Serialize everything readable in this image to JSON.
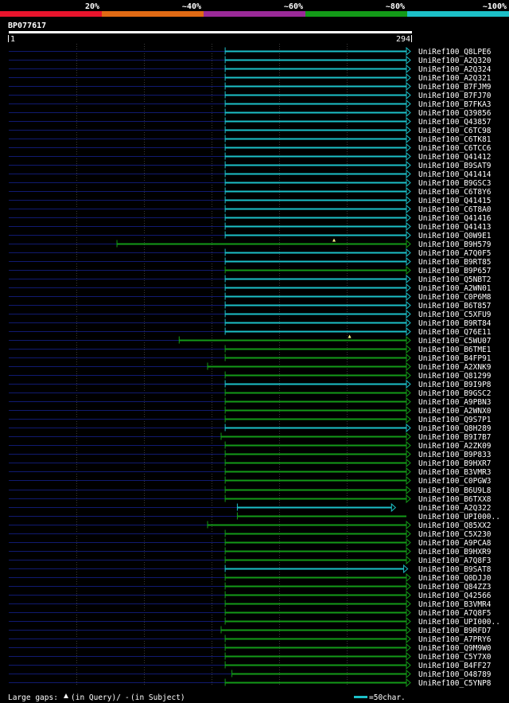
{
  "chart_data": {
    "type": "alignment",
    "query": {
      "name": "BP077617",
      "length": 294,
      "start_label": "1",
      "end_label": "294"
    },
    "identity_legend": [
      {
        "label": "20%",
        "color": "#e8142c"
      },
      {
        "label": "~40%",
        "color": "#e06a14"
      },
      {
        "label": "~60%",
        "color": "#9a2a98"
      },
      {
        "label": "~80%",
        "color": "#139a18"
      },
      {
        "label": "~100%",
        "color": "#1cc0c8"
      }
    ],
    "colors": {
      "cyan": "#1cc0c8",
      "green": "#139a18",
      "navy": "#101a70",
      "grid": "#3a3a3a",
      "white": "#ffffff"
    },
    "hits": [
      {
        "name": "UniRef100_Q8LPE6",
        "start": 160,
        "end": 294,
        "color": "cyan",
        "arrow": true
      },
      {
        "name": "UniRef100_A2Q320",
        "start": 160,
        "end": 294,
        "color": "cyan",
        "arrow": true
      },
      {
        "name": "UniRef100_A2Q324",
        "start": 160,
        "end": 294,
        "color": "cyan",
        "arrow": true
      },
      {
        "name": "UniRef100_A2Q321",
        "start": 160,
        "end": 294,
        "color": "cyan",
        "arrow": true
      },
      {
        "name": "UniRef100_B7FJM9",
        "start": 160,
        "end": 294,
        "color": "cyan",
        "arrow": true
      },
      {
        "name": "UniRef100_B7FJ70",
        "start": 160,
        "end": 294,
        "color": "cyan",
        "arrow": true
      },
      {
        "name": "UniRef100_B7FKA3",
        "start": 160,
        "end": 294,
        "color": "cyan",
        "arrow": true
      },
      {
        "name": "UniRef100_Q39856",
        "start": 160,
        "end": 294,
        "color": "cyan",
        "arrow": true
      },
      {
        "name": "UniRef100_Q43857",
        "start": 160,
        "end": 294,
        "color": "cyan",
        "arrow": true
      },
      {
        "name": "UniRef100_C6TC98",
        "start": 160,
        "end": 294,
        "color": "cyan",
        "arrow": true
      },
      {
        "name": "UniRef100_C6TK81",
        "start": 160,
        "end": 294,
        "color": "cyan",
        "arrow": true
      },
      {
        "name": "UniRef100_C6TCC6",
        "start": 160,
        "end": 294,
        "color": "cyan",
        "arrow": true
      },
      {
        "name": "UniRef100_Q41412",
        "start": 160,
        "end": 294,
        "color": "cyan",
        "arrow": true
      },
      {
        "name": "UniRef100_B9SAT9",
        "start": 160,
        "end": 294,
        "color": "cyan",
        "arrow": true
      },
      {
        "name": "UniRef100_Q41414",
        "start": 160,
        "end": 294,
        "color": "cyan",
        "arrow": true
      },
      {
        "name": "UniRef100_B9GSC3",
        "start": 160,
        "end": 294,
        "color": "cyan",
        "arrow": true
      },
      {
        "name": "UniRef100_C6T8Y6",
        "start": 160,
        "end": 294,
        "color": "cyan",
        "arrow": true
      },
      {
        "name": "UniRef100_Q41415",
        "start": 160,
        "end": 294,
        "color": "cyan",
        "arrow": true
      },
      {
        "name": "UniRef100_C6T8A0",
        "start": 160,
        "end": 294,
        "color": "cyan",
        "arrow": true
      },
      {
        "name": "UniRef100_Q41416",
        "start": 160,
        "end": 294,
        "color": "cyan",
        "arrow": true
      },
      {
        "name": "UniRef100_Q41413",
        "start": 160,
        "end": 294,
        "color": "cyan",
        "arrow": true
      },
      {
        "name": "UniRef100_Q0W9E1",
        "start": 160,
        "end": 294,
        "color": "cyan",
        "arrow": true
      },
      {
        "name": "UniRef100_B9H579",
        "start": 80,
        "end": 294,
        "color": "green",
        "arrow": true,
        "gap": "query"
      },
      {
        "name": "UniRef100_A7Q0F5",
        "start": 160,
        "end": 294,
        "color": "cyan",
        "arrow": true
      },
      {
        "name": "UniRef100_B9RT85",
        "start": 160,
        "end": 294,
        "color": "cyan",
        "arrow": true
      },
      {
        "name": "UniRef100_B9P657",
        "start": 160,
        "end": 294,
        "color": "green",
        "arrow": true
      },
      {
        "name": "UniRef100_Q5NBT2",
        "start": 160,
        "end": 294,
        "color": "cyan",
        "arrow": true
      },
      {
        "name": "UniRef100_A2WN01",
        "start": 160,
        "end": 294,
        "color": "cyan",
        "arrow": true
      },
      {
        "name": "UniRef100_C0P6M8",
        "start": 160,
        "end": 294,
        "color": "cyan",
        "arrow": true
      },
      {
        "name": "UniRef100_B6T857",
        "start": 160,
        "end": 294,
        "color": "cyan",
        "arrow": true
      },
      {
        "name": "UniRef100_C5XFU9",
        "start": 160,
        "end": 294,
        "color": "cyan",
        "arrow": true
      },
      {
        "name": "UniRef100_B9RT84",
        "start": 160,
        "end": 294,
        "color": "cyan",
        "arrow": true
      },
      {
        "name": "UniRef100_Q76E11",
        "start": 160,
        "end": 294,
        "color": "cyan",
        "arrow": true
      },
      {
        "name": "UniRef100_C5WU07",
        "start": 126,
        "end": 294,
        "color": "green",
        "arrow": true,
        "gap": "query"
      },
      {
        "name": "UniRef100_B6TME1",
        "start": 160,
        "end": 294,
        "color": "green",
        "arrow": true
      },
      {
        "name": "UniRef100_B4FP91",
        "start": 160,
        "end": 294,
        "color": "green",
        "arrow": true
      },
      {
        "name": "UniRef100_A2XNK9",
        "start": 147,
        "end": 294,
        "color": "green",
        "arrow": true
      },
      {
        "name": "UniRef100_Q81299",
        "start": 160,
        "end": 294,
        "color": "green",
        "arrow": true
      },
      {
        "name": "UniRef100_B9I9P8",
        "start": 160,
        "end": 294,
        "color": "cyan",
        "arrow": true
      },
      {
        "name": "UniRef100_B9GSC2",
        "start": 160,
        "end": 294,
        "color": "green",
        "arrow": true
      },
      {
        "name": "UniRef100_A9PBN3",
        "start": 160,
        "end": 294,
        "color": "green",
        "arrow": true
      },
      {
        "name": "UniRef100_A2WNX0",
        "start": 160,
        "end": 294,
        "color": "green",
        "arrow": true
      },
      {
        "name": "UniRef100_Q9S7P1",
        "start": 160,
        "end": 294,
        "color": "green",
        "arrow": true
      },
      {
        "name": "UniRef100_Q8H289",
        "start": 160,
        "end": 294,
        "color": "cyan",
        "arrow": true
      },
      {
        "name": "UniRef100_B9I7B7",
        "start": 157,
        "end": 294,
        "color": "green",
        "arrow": true
      },
      {
        "name": "UniRef100_A2ZK09",
        "start": 160,
        "end": 294,
        "color": "green",
        "arrow": true
      },
      {
        "name": "UniRef100_B9P833",
        "start": 160,
        "end": 294,
        "color": "green",
        "arrow": true
      },
      {
        "name": "UniRef100_B9HXR7",
        "start": 160,
        "end": 294,
        "color": "green",
        "arrow": true
      },
      {
        "name": "UniRef100_B3VMR3",
        "start": 160,
        "end": 294,
        "color": "green",
        "arrow": true
      },
      {
        "name": "UniRef100_C0PGW3",
        "start": 160,
        "end": 294,
        "color": "green",
        "arrow": true
      },
      {
        "name": "UniRef100_B6U9L8",
        "start": 160,
        "end": 294,
        "color": "green",
        "arrow": true
      },
      {
        "name": "UniRef100_B6TXX8",
        "start": 160,
        "end": 294,
        "color": "green",
        "arrow": true
      },
      {
        "name": "UniRef100_A2Q322",
        "start": 169,
        "end": 283,
        "color": "cyan",
        "arrow": true
      },
      {
        "name": "UniRef100_UPI000..",
        "start": 169,
        "end": 294,
        "color": "green",
        "arrow": false
      },
      {
        "name": "UniRef100_Q85XX2",
        "start": 147,
        "end": 294,
        "color": "green",
        "arrow": true
      },
      {
        "name": "UniRef100_C5X230",
        "start": 160,
        "end": 294,
        "color": "green",
        "arrow": true
      },
      {
        "name": "UniRef100_A9PCA8",
        "start": 160,
        "end": 294,
        "color": "green",
        "arrow": true
      },
      {
        "name": "UniRef100_B9HXR9",
        "start": 160,
        "end": 294,
        "color": "green",
        "arrow": true
      },
      {
        "name": "UniRef100_A7Q8F3",
        "start": 160,
        "end": 294,
        "color": "green",
        "arrow": true
      },
      {
        "name": "UniRef100_B9SAT8",
        "start": 160,
        "end": 292,
        "color": "cyan",
        "arrow": true
      },
      {
        "name": "UniRef100_Q0DJJ0",
        "start": 160,
        "end": 294,
        "color": "green",
        "arrow": true
      },
      {
        "name": "UniRef100_Q84ZZ3",
        "start": 160,
        "end": 294,
        "color": "green",
        "arrow": true
      },
      {
        "name": "UniRef100_Q42566",
        "start": 160,
        "end": 294,
        "color": "green",
        "arrow": true
      },
      {
        "name": "UniRef100_B3VMR4",
        "start": 160,
        "end": 294,
        "color": "green",
        "arrow": true
      },
      {
        "name": "UniRef100_A7Q8F5",
        "start": 160,
        "end": 294,
        "color": "green",
        "arrow": true
      },
      {
        "name": "UniRef100_UPI000..",
        "start": 160,
        "end": 294,
        "color": "green",
        "arrow": true
      },
      {
        "name": "UniRef100_B9RFD7",
        "start": 157,
        "end": 294,
        "color": "green",
        "arrow": true
      },
      {
        "name": "UniRef100_A7PRY6",
        "start": 160,
        "end": 294,
        "color": "green",
        "arrow": true
      },
      {
        "name": "UniRef100_Q9M9W0",
        "start": 160,
        "end": 294,
        "color": "green",
        "arrow": true
      },
      {
        "name": "UniRef100_C5Y7X0",
        "start": 160,
        "end": 294,
        "color": "green",
        "arrow": true
      },
      {
        "name": "UniRef100_B4FF27",
        "start": 160,
        "end": 294,
        "color": "green",
        "arrow": true
      },
      {
        "name": "UniRef100_O48789",
        "start": 165,
        "end": 294,
        "color": "green",
        "arrow": true
      },
      {
        "name": "UniRef100_C5YNP8",
        "start": 160,
        "end": 294,
        "color": "green",
        "arrow": true
      }
    ],
    "gridlines": [
      50,
      100,
      150,
      200,
      250
    ],
    "footer": {
      "large_gaps_text": "Large gaps:",
      "in_query_text": "(in Query)/",
      "dash": "-",
      "in_subject_text": "(in Subject)",
      "scale_text": "=50char."
    }
  }
}
